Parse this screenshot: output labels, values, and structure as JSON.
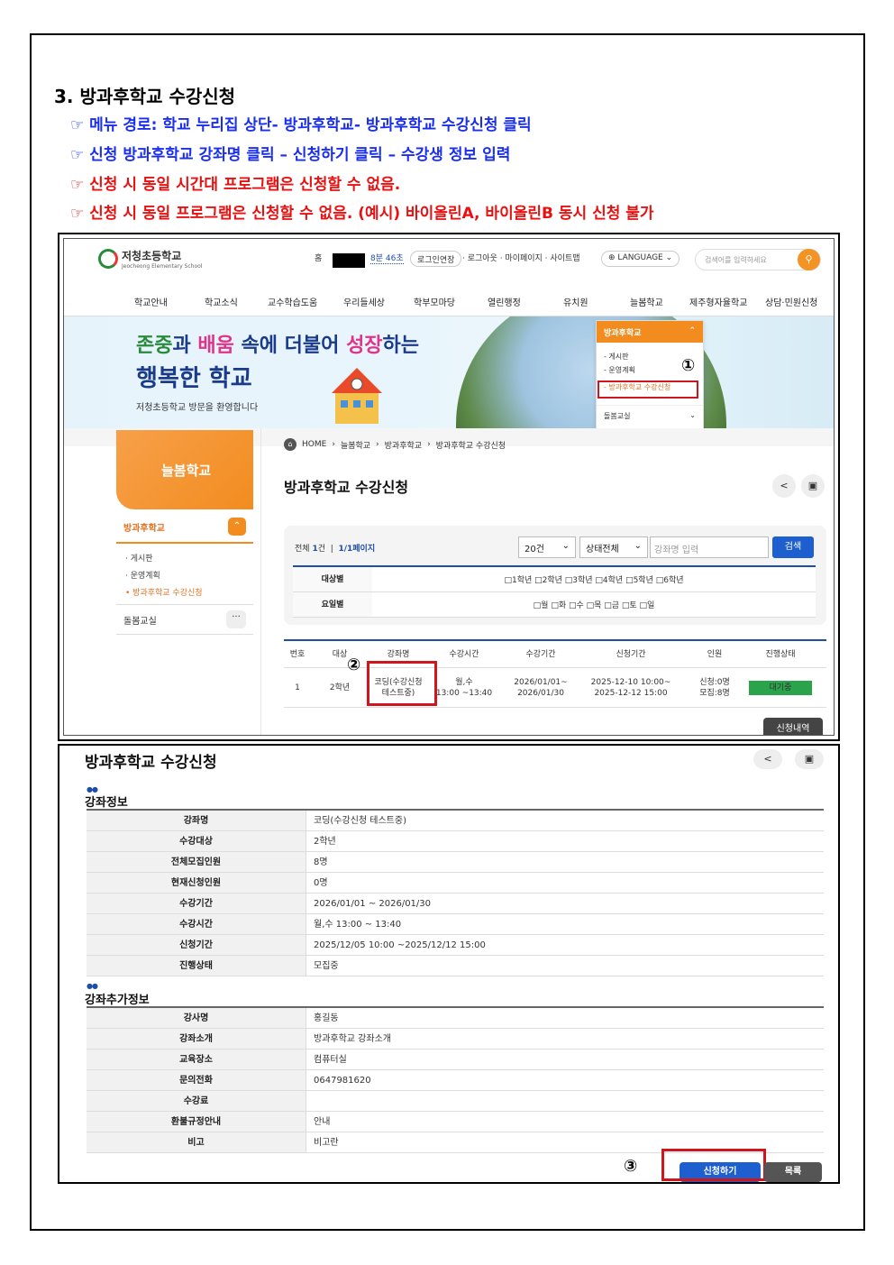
{
  "doc": {
    "heading": "3. 방과후학교 수강신청",
    "instructions": [
      "☞ 메뉴 경로: 학교 누리집 상단- 방과후학교- 방과후학교 수강신청 클릭",
      "☞ 신청 방과후학교 강좌명 클릭 – 신청하기 클릭 – 수강생 정보 입력",
      "☞ 신청 시 동일 시간대 프로그램은 신청할 수 없음.",
      "☞ 신청 시 동일 프로그램은 신청할 수 없음. (예시) 바이올린A, 바이올린B 동시 신청 불가"
    ]
  },
  "site": {
    "logo_name": "저청초등학교",
    "logo_sub": "Jeocheong Elementary School",
    "util": {
      "home": "홈",
      "timer": "8분 46초",
      "extend": "로그인연장",
      "logout": "· 로그아웃 · 마이페이지 · 사이트맵",
      "language": "LANGUAGE",
      "search_placeholder": "검색어를 입력하세요"
    },
    "gnb": [
      "학교안내",
      "학교소식",
      "교수학습도움",
      "우리들세상",
      "학부모마당",
      "열린행정",
      "유치원",
      "늘봄학교",
      "제주형자율학교",
      "상담·민원신청"
    ],
    "banner": {
      "line1_a": "존중",
      "line1_b": "과 ",
      "line1_c": "배움",
      "line1_d": " 속에 더불어 ",
      "line1_e": "성장",
      "line1_f": "하는",
      "line2": "행복한 학교",
      "line3": "저청초등학교 방문을 환영합니다"
    },
    "dropdown": {
      "head": "방과후학교",
      "items": [
        "- 게시판",
        "- 운영계획",
        "- 방과후학교 수강신청"
      ],
      "other": "돌봄교실"
    },
    "markers": [
      "①",
      "②",
      "③"
    ],
    "snb": {
      "title": "늘봄학교",
      "group": "방과후학교",
      "subs": [
        "· 게시판",
        "· 운영계획",
        "• 방과후학교 수강신청"
      ],
      "group2": "돌봄교실"
    },
    "breadcrumb": [
      "HOME",
      "늘봄학교",
      "방과후학교",
      "방과후학교 수강신청"
    ],
    "page_title": "방과후학교 수강신청",
    "filter": {
      "total_label": "전체",
      "total_count": "1",
      "total_unit": "건",
      "page_info": "1/1페이지",
      "per_page": "20건",
      "status": "상태전체",
      "input_placeholder": "강좌명 입력",
      "search_btn": "검색",
      "target_label": "대상별",
      "target_options": "□1학년  □2학년  □3학년  □4학년  □5학년  □6학년",
      "day_label": "요일별",
      "day_options": "□월  □화  □수  □목  □금  □토  □일"
    },
    "list": {
      "headers": [
        "번호",
        "대상",
        "강좌명",
        "수강시간",
        "수강기간",
        "신청기간",
        "인원",
        "진행상태"
      ],
      "row": {
        "no": "1",
        "target": "2학년",
        "course": "코딩(수강신청 테스트중)",
        "time_a": "월,수",
        "time_b": "13:00 ~13:40",
        "period_a": "2026/01/01~",
        "period_b": "2026/01/30",
        "apply_a": "2025-12-10 10:00~",
        "apply_b": "2025-12-12 15:00",
        "people_a": "신청:0명",
        "people_b": "모집:8명",
        "status": "대기중"
      }
    },
    "history_btn": "신청내역"
  },
  "detail": {
    "title": "방과후학교 수강신청",
    "sec1": "강좌정보",
    "rows1": [
      [
        "강좌명",
        "코딩(수강신청 테스트중)"
      ],
      [
        "수강대상",
        "2학년"
      ],
      [
        "전체모집인원",
        "8명"
      ],
      [
        "현재신청인원",
        "0명"
      ],
      [
        "수강기간",
        "2026/01/01 ~ 2026/01/30"
      ],
      [
        "수강시간",
        "월,수 13:00 ~ 13:40"
      ],
      [
        "신청기간",
        "2025/12/05 10:00 ~2025/12/12 15:00"
      ],
      [
        "진행상태",
        "모집중"
      ]
    ],
    "sec2": "강좌추가정보",
    "rows2": [
      [
        "강사명",
        "홍길동"
      ],
      [
        "강좌소개",
        "방과후학교 강좌소개"
      ],
      [
        "교육장소",
        "컴퓨터실"
      ],
      [
        "문의전화",
        "0647981620"
      ],
      [
        "수강료",
        ""
      ],
      [
        "환불규정안내",
        "안내"
      ],
      [
        "비고",
        "비고란"
      ]
    ],
    "apply_btn": "신청하기",
    "list_btn": "목록"
  },
  "colors": {
    "blue": "#1a2ef0",
    "red": "#e81010",
    "orange": "#f28c1f",
    "highlight": "#d0161d"
  }
}
